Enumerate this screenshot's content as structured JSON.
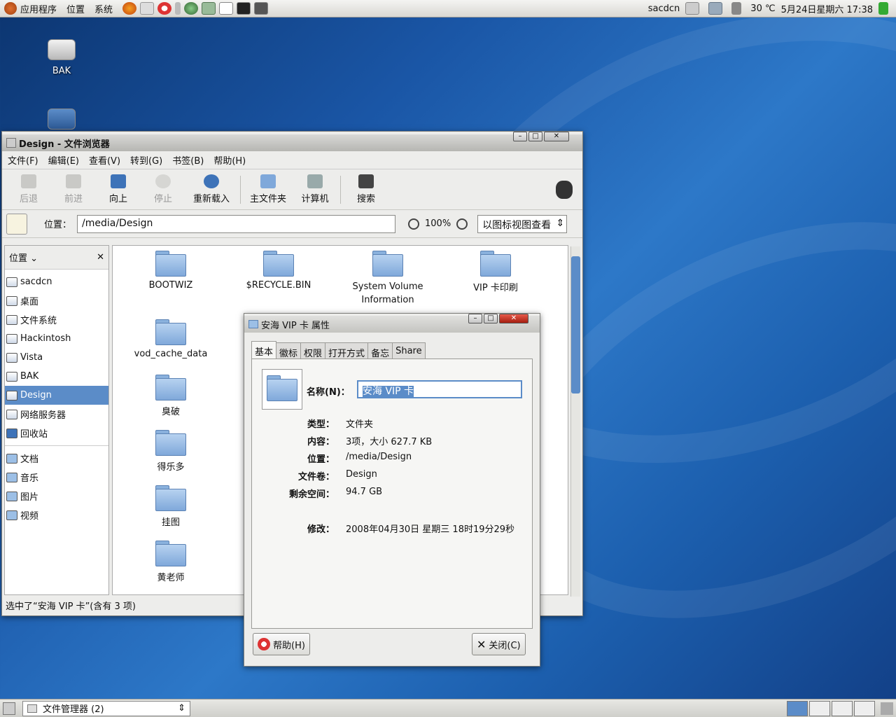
{
  "top_panel": {
    "menus": [
      "应用程序",
      "位置",
      "系统"
    ],
    "user": "sacdcn",
    "weather": "30 ℃",
    "datetime": "5月24日星期六 17:38"
  },
  "desktop": {
    "icons": [
      "BAK",
      ""
    ]
  },
  "browser": {
    "title": "Design - 文件浏览器",
    "menus": [
      "文件(F)",
      "编辑(E)",
      "查看(V)",
      "转到(G)",
      "书签(B)",
      "帮助(H)"
    ],
    "toolbar": {
      "back": "后退",
      "forward": "前进",
      "up": "向上",
      "stop": "停止",
      "reload": "重新载入",
      "home": "主文件夹",
      "computer": "计算机",
      "search": "搜索"
    },
    "location_label": "位置：",
    "location": "/media/Design",
    "zoom": "100%",
    "view_mode": "以图标视图查看",
    "sidebar": {
      "header": "位置",
      "items": [
        "sacdcn",
        "桌面",
        "文件系统",
        "Hackintosh",
        "Vista",
        "BAK",
        "Design",
        "网络服务器",
        "回收站"
      ],
      "bookmarks": [
        "文档",
        "音乐",
        "图片",
        "视频"
      ]
    },
    "files": [
      "BOOTWIZ",
      "$RECYCLE.BIN",
      "System Volume Information",
      "VIP 卡印刷",
      "vod_cache_data",
      "臭破",
      "得乐多",
      "挂图",
      "黄老师"
    ],
    "status": "选中了“安海 VIP 卡”(含有 3 项)"
  },
  "dialog": {
    "title": "安海 VIP 卡 属性",
    "tabs": [
      "基本",
      "徽标",
      "权限",
      "打开方式",
      "备忘",
      "Share"
    ],
    "name_label": "名称(N)：",
    "name_value": "安海 VIP 卡",
    "rows": [
      {
        "label": "类型：",
        "value": "文件夹"
      },
      {
        "label": "内容：",
        "value": "3项，大小 627.7 KB"
      },
      {
        "label": "位置：",
        "value": "/media/Design"
      },
      {
        "label": "文件卷：",
        "value": "Design"
      },
      {
        "label": "剩余空间：",
        "value": "94.7 GB"
      }
    ],
    "modified_label": "修改：",
    "modified_value": "2008年04月30日 星期三 18时19分29秒",
    "help": "帮助(H)",
    "close": "关闭(C)"
  },
  "taskbar": {
    "task": "文件管理器 (2)"
  },
  "colors": {
    "selection": "#5b8cc8",
    "folder": "#9cbfe6"
  }
}
